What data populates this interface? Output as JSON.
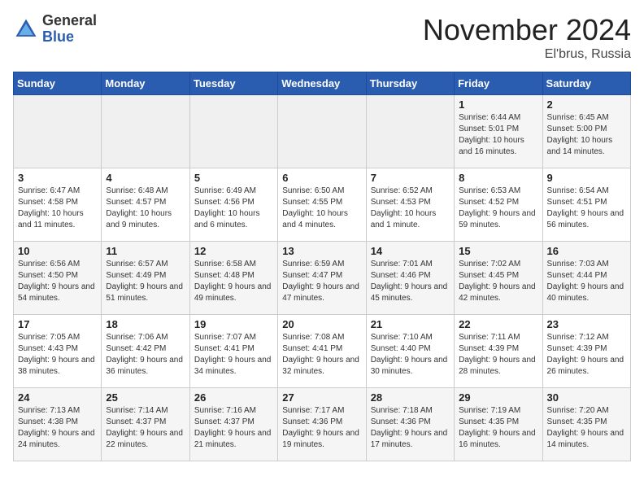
{
  "logo": {
    "general": "General",
    "blue": "Blue"
  },
  "header": {
    "month": "November 2024",
    "location": "El'brus, Russia"
  },
  "days_of_week": [
    "Sunday",
    "Monday",
    "Tuesday",
    "Wednesday",
    "Thursday",
    "Friday",
    "Saturday"
  ],
  "weeks": [
    [
      {
        "day": "",
        "info": ""
      },
      {
        "day": "",
        "info": ""
      },
      {
        "day": "",
        "info": ""
      },
      {
        "day": "",
        "info": ""
      },
      {
        "day": "",
        "info": ""
      },
      {
        "day": "1",
        "info": "Sunrise: 6:44 AM\nSunset: 5:01 PM\nDaylight: 10 hours and 16 minutes."
      },
      {
        "day": "2",
        "info": "Sunrise: 6:45 AM\nSunset: 5:00 PM\nDaylight: 10 hours and 14 minutes."
      }
    ],
    [
      {
        "day": "3",
        "info": "Sunrise: 6:47 AM\nSunset: 4:58 PM\nDaylight: 10 hours and 11 minutes."
      },
      {
        "day": "4",
        "info": "Sunrise: 6:48 AM\nSunset: 4:57 PM\nDaylight: 10 hours and 9 minutes."
      },
      {
        "day": "5",
        "info": "Sunrise: 6:49 AM\nSunset: 4:56 PM\nDaylight: 10 hours and 6 minutes."
      },
      {
        "day": "6",
        "info": "Sunrise: 6:50 AM\nSunset: 4:55 PM\nDaylight: 10 hours and 4 minutes."
      },
      {
        "day": "7",
        "info": "Sunrise: 6:52 AM\nSunset: 4:53 PM\nDaylight: 10 hours and 1 minute."
      },
      {
        "day": "8",
        "info": "Sunrise: 6:53 AM\nSunset: 4:52 PM\nDaylight: 9 hours and 59 minutes."
      },
      {
        "day": "9",
        "info": "Sunrise: 6:54 AM\nSunset: 4:51 PM\nDaylight: 9 hours and 56 minutes."
      }
    ],
    [
      {
        "day": "10",
        "info": "Sunrise: 6:56 AM\nSunset: 4:50 PM\nDaylight: 9 hours and 54 minutes."
      },
      {
        "day": "11",
        "info": "Sunrise: 6:57 AM\nSunset: 4:49 PM\nDaylight: 9 hours and 51 minutes."
      },
      {
        "day": "12",
        "info": "Sunrise: 6:58 AM\nSunset: 4:48 PM\nDaylight: 9 hours and 49 minutes."
      },
      {
        "day": "13",
        "info": "Sunrise: 6:59 AM\nSunset: 4:47 PM\nDaylight: 9 hours and 47 minutes."
      },
      {
        "day": "14",
        "info": "Sunrise: 7:01 AM\nSunset: 4:46 PM\nDaylight: 9 hours and 45 minutes."
      },
      {
        "day": "15",
        "info": "Sunrise: 7:02 AM\nSunset: 4:45 PM\nDaylight: 9 hours and 42 minutes."
      },
      {
        "day": "16",
        "info": "Sunrise: 7:03 AM\nSunset: 4:44 PM\nDaylight: 9 hours and 40 minutes."
      }
    ],
    [
      {
        "day": "17",
        "info": "Sunrise: 7:05 AM\nSunset: 4:43 PM\nDaylight: 9 hours and 38 minutes."
      },
      {
        "day": "18",
        "info": "Sunrise: 7:06 AM\nSunset: 4:42 PM\nDaylight: 9 hours and 36 minutes."
      },
      {
        "day": "19",
        "info": "Sunrise: 7:07 AM\nSunset: 4:41 PM\nDaylight: 9 hours and 34 minutes."
      },
      {
        "day": "20",
        "info": "Sunrise: 7:08 AM\nSunset: 4:41 PM\nDaylight: 9 hours and 32 minutes."
      },
      {
        "day": "21",
        "info": "Sunrise: 7:10 AM\nSunset: 4:40 PM\nDaylight: 9 hours and 30 minutes."
      },
      {
        "day": "22",
        "info": "Sunrise: 7:11 AM\nSunset: 4:39 PM\nDaylight: 9 hours and 28 minutes."
      },
      {
        "day": "23",
        "info": "Sunrise: 7:12 AM\nSunset: 4:39 PM\nDaylight: 9 hours and 26 minutes."
      }
    ],
    [
      {
        "day": "24",
        "info": "Sunrise: 7:13 AM\nSunset: 4:38 PM\nDaylight: 9 hours and 24 minutes."
      },
      {
        "day": "25",
        "info": "Sunrise: 7:14 AM\nSunset: 4:37 PM\nDaylight: 9 hours and 22 minutes."
      },
      {
        "day": "26",
        "info": "Sunrise: 7:16 AM\nSunset: 4:37 PM\nDaylight: 9 hours and 21 minutes."
      },
      {
        "day": "27",
        "info": "Sunrise: 7:17 AM\nSunset: 4:36 PM\nDaylight: 9 hours and 19 minutes."
      },
      {
        "day": "28",
        "info": "Sunrise: 7:18 AM\nSunset: 4:36 PM\nDaylight: 9 hours and 17 minutes."
      },
      {
        "day": "29",
        "info": "Sunrise: 7:19 AM\nSunset: 4:35 PM\nDaylight: 9 hours and 16 minutes."
      },
      {
        "day": "30",
        "info": "Sunrise: 7:20 AM\nSunset: 4:35 PM\nDaylight: 9 hours and 14 minutes."
      }
    ]
  ]
}
